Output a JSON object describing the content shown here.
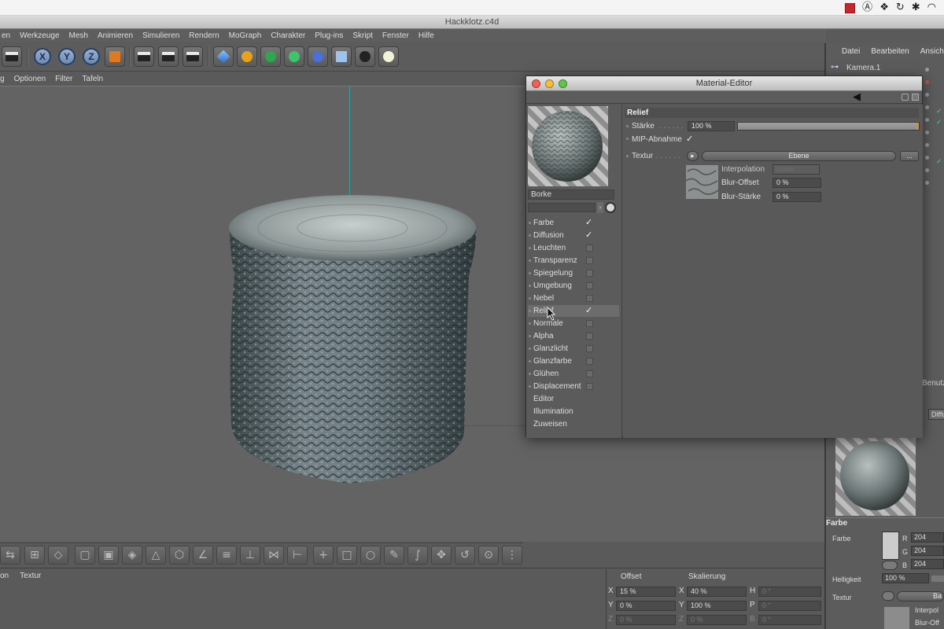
{
  "window_title": "Hackklotz.c4d",
  "app_menu": [
    "en",
    "Werkzeuge",
    "Mesh",
    "Animieren",
    "Simulieren",
    "Rendern",
    "MoGraph",
    "Charakter",
    "Plug-ins",
    "Skript",
    "Fenster",
    "Hilfe"
  ],
  "toolbar": {
    "x_label": "X",
    "y_label": "Y",
    "z_label": "Z"
  },
  "view_menu": [
    "g",
    "Optionen",
    "Filter",
    "Tafeln"
  ],
  "object_manager": {
    "menu": [
      "Datei",
      "Bearbeiten",
      "Ansicht"
    ],
    "object_name": "Kamera.1"
  },
  "material_editor": {
    "title": "Material-Editor",
    "material_name": "Borke",
    "channels": [
      {
        "label": "Farbe",
        "checked": true
      },
      {
        "label": "Diffusion",
        "checked": true
      },
      {
        "label": "Leuchten",
        "checked": false
      },
      {
        "label": "Transparenz",
        "checked": false
      },
      {
        "label": "Spiegelung",
        "checked": false
      },
      {
        "label": "Umgebung",
        "checked": false
      },
      {
        "label": "Nebel",
        "checked": false
      },
      {
        "label": "Relief",
        "checked": true,
        "selected": true
      },
      {
        "label": "Normale",
        "checked": false
      },
      {
        "label": "Alpha",
        "checked": false
      },
      {
        "label": "Glanzlicht",
        "checked": false
      },
      {
        "label": "Glanzfarbe",
        "checked": false
      },
      {
        "label": "Glühen",
        "checked": false
      },
      {
        "label": "Displacement",
        "checked": false
      },
      {
        "label": "Editor",
        "checked": null
      },
      {
        "label": "Illumination",
        "checked": null
      },
      {
        "label": "Zuweisen",
        "checked": null
      }
    ],
    "section_title": "Relief",
    "staerke_label": "Stärke",
    "staerke_value": "100 %",
    "staerke_fraction": 1.0,
    "mip_label": "MIP-Abnahme",
    "textur_label": "Textur",
    "ebene_button": "Ebene",
    "more_button": "...",
    "interpolation_label": "Interpolation",
    "interpolation_value": "Keine",
    "blur_offset_label": "Blur-Offset",
    "blur_offset_value": "0 %",
    "blur_staerke_label": "Blur-Stärke",
    "blur_staerke_value": "0 %"
  },
  "bottom_panel": {
    "menu": [
      "on",
      "Textur"
    ],
    "offset_header": "Offset",
    "scale_header": "Skalierung",
    "x_offset": "15 %",
    "y_offset": "0 %",
    "z_offset": "0 %",
    "x_scale": "40 %",
    "y_scale": "100 %",
    "z_scale": "0 %",
    "h_value": "0 °",
    "p_value": "0 °",
    "b_value": "0 °"
  },
  "attributes": {
    "tab_partial": "Benutz",
    "diffusion_partial": "Diffu",
    "farbe_header": "Farbe",
    "farbe_label": "Farbe",
    "r_value": "204",
    "g_value": "204",
    "b_value": "204",
    "helligkeit_label": "Helligkeit",
    "helligkeit_value": "100 %",
    "textur_label": "Textur",
    "interpolation_partial": "Interpol",
    "blur_partial": "Blur-Off",
    "button_partial": "Ba"
  },
  "colors": {
    "accent_axis_green": "#3b9d9c",
    "accent_axis_red": "#b0302e",
    "checkbox_teal": "#46d1a0"
  }
}
